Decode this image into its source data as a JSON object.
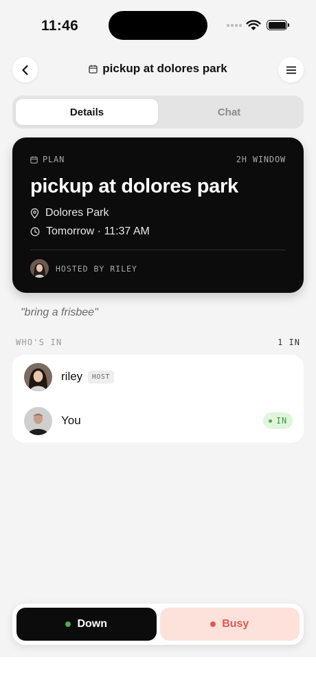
{
  "status_bar": {
    "time": "11:46"
  },
  "header": {
    "title": "pickup at dolores park"
  },
  "tabs": [
    {
      "label": "Details",
      "active": true
    },
    {
      "label": "Chat",
      "active": false
    }
  ],
  "plan": {
    "kicker": "PLAN",
    "window": "2H WINDOW",
    "title": "pickup at dolores park",
    "location": "Dolores Park",
    "time": "Tomorrow · 11:37 AM",
    "hosted_by": "HOSTED BY RILEY"
  },
  "note": "\"bring a frisbee\"",
  "attendees": {
    "section_label": "WHO'S IN",
    "count": "1 IN",
    "people": [
      {
        "name": "riley",
        "badge": "HOST"
      },
      {
        "name": "You",
        "status": "IN"
      }
    ]
  },
  "actions": {
    "down_label": "Down",
    "busy_label": "Busy"
  },
  "colors": {
    "card_dark": "#0c0c0c",
    "down_dot": "#4caf50",
    "busy_bg": "#fde2dc",
    "busy_text": "#e0584f",
    "in_badge_bg": "#dff5dc",
    "in_badge_text": "#3a9a3a"
  }
}
